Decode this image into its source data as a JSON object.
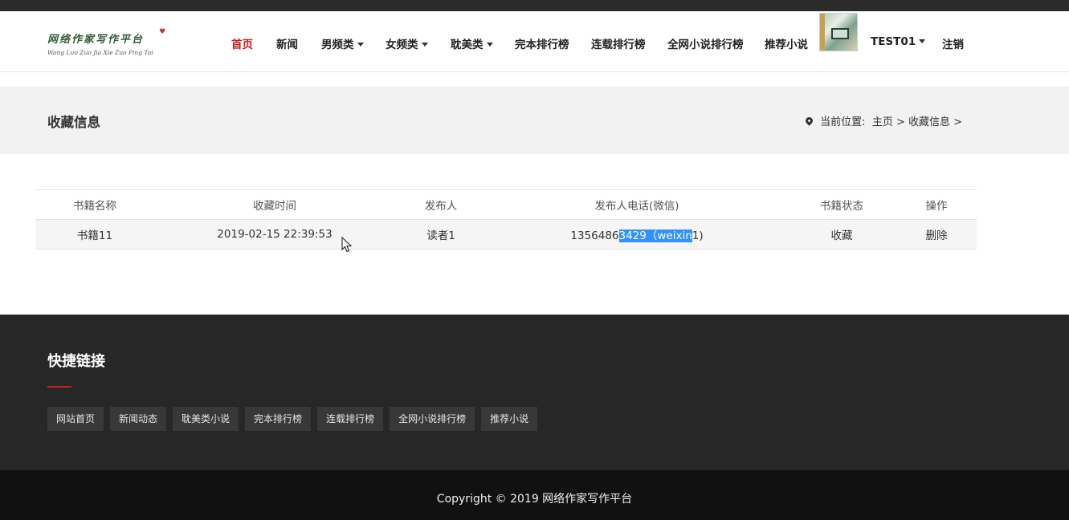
{
  "logo": {
    "name_cn": "网络作家写作平台",
    "name_pinyin": "Wang Luo Zuo Jia Xie Zuo Ping Tai"
  },
  "nav": {
    "items": [
      {
        "label": "首页",
        "active": true,
        "dropdown": false
      },
      {
        "label": "新闻",
        "active": false,
        "dropdown": false
      },
      {
        "label": "男频类",
        "active": false,
        "dropdown": true
      },
      {
        "label": "女频类",
        "active": false,
        "dropdown": true
      },
      {
        "label": "耽美类",
        "active": false,
        "dropdown": true
      },
      {
        "label": "完本排行榜",
        "active": false,
        "dropdown": false
      },
      {
        "label": "连载排行榜",
        "active": false,
        "dropdown": false
      },
      {
        "label": "全网小说排行榜",
        "active": false,
        "dropdown": false
      },
      {
        "label": "推荐小说",
        "active": false,
        "dropdown": false
      }
    ],
    "user": "TEST01",
    "logout": "注销"
  },
  "page": {
    "title": "收藏信息",
    "breadcrumb_prefix": "当前位置:",
    "breadcrumb": "主页 > 收藏信息 >"
  },
  "table": {
    "headers": [
      "书籍名称",
      "收藏时间",
      "发布人",
      "发布人电话(微信)",
      "书籍状态",
      "操作"
    ],
    "rows": [
      {
        "book": "书籍11",
        "time": "2019-02-15 22:39:53",
        "publisher": "读者1",
        "phone_pre": "1356486",
        "phone_sel": "3429（weixin",
        "phone_post": "1)",
        "status": "收藏",
        "action": "删除"
      }
    ]
  },
  "footer": {
    "title": "快捷链接",
    "links": [
      "网站首页",
      "新闻动态",
      "耽美类小说",
      "完本排行榜",
      "连载排行榜",
      "全网小说排行榜",
      "推荐小说"
    ],
    "copyright": "Copyright © 2019 网络作家写作平台"
  },
  "colors": {
    "accent": "#c8201f",
    "footer_bg": "#272727",
    "copyright_bg": "#111111",
    "selection": "#3390ff"
  }
}
